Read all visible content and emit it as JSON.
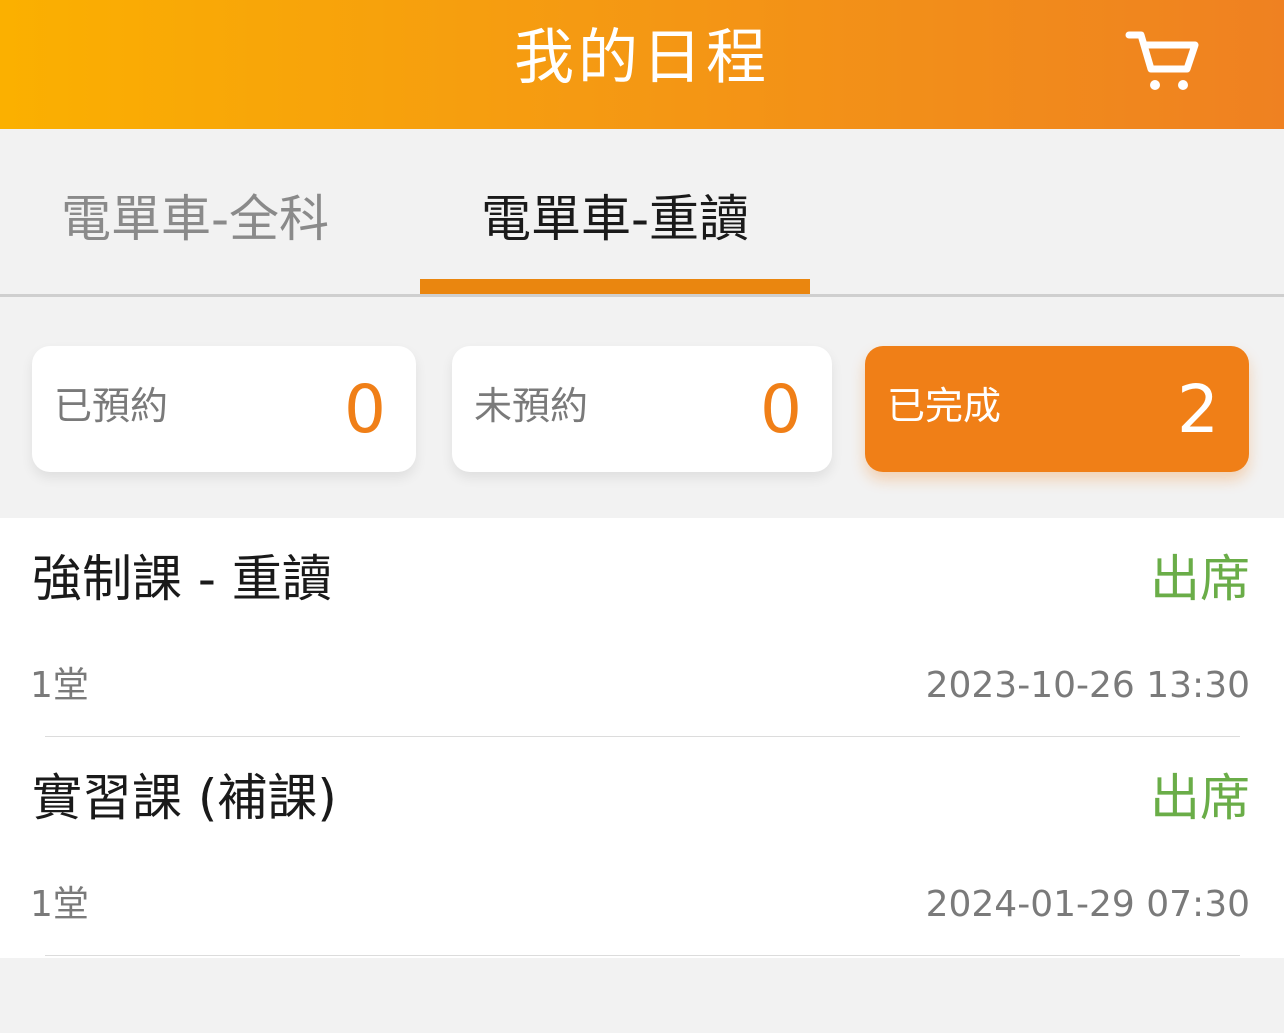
{
  "header": {
    "title": "我的日程",
    "cart_icon": "shopping-cart-icon"
  },
  "tabs": [
    {
      "label": "電單車-全科",
      "active": false
    },
    {
      "label": "電單車-重讀",
      "active": true
    }
  ],
  "stats": {
    "booked": {
      "label": "已預約",
      "count": "0"
    },
    "unbooked": {
      "label": "未預約",
      "count": "0"
    },
    "completed": {
      "label": "已完成",
      "count": "2",
      "selected": true
    }
  },
  "records": [
    {
      "title": "強制課 - 重讀",
      "status": "出席",
      "lessons": "1堂",
      "datetime": "2023-10-26 13:30"
    },
    {
      "title": "實習課 (補課)",
      "status": "出席",
      "lessons": "1堂",
      "datetime": "2024-01-29 07:30"
    }
  ],
  "colors": {
    "header_gradient_start": "#fbb000",
    "header_gradient_end": "#ef8121",
    "accent": "#f07f17",
    "status_present": "#6aad48"
  }
}
